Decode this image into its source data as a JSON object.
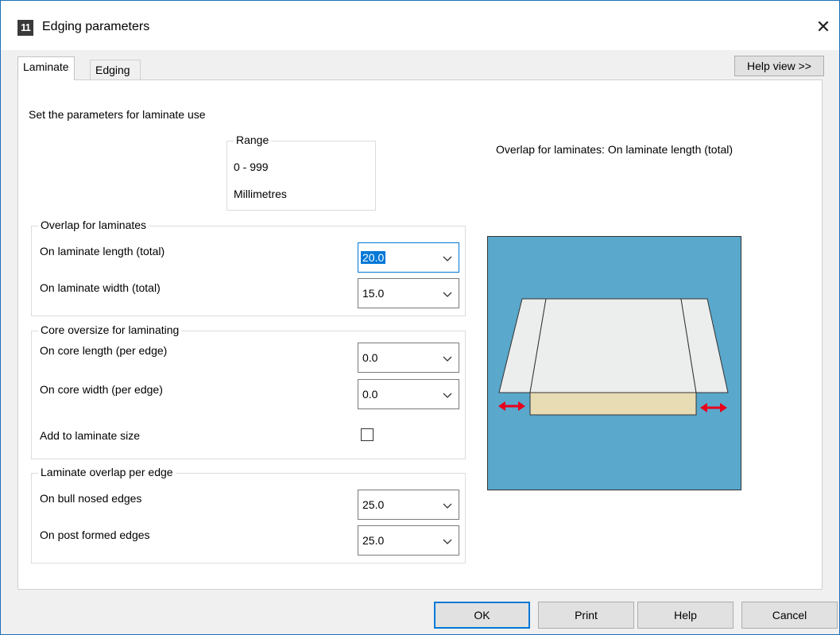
{
  "window": {
    "app_icon": "11",
    "title": "Edging parameters",
    "close_glyph": "✕"
  },
  "tabs": [
    {
      "label": "Laminate",
      "selected": true
    },
    {
      "label": "Edging",
      "selected": false
    }
  ],
  "help_view_label": "Help view >>",
  "intro": "Set the parameters for laminate use",
  "range": {
    "title": "Range",
    "values": "0 - 999",
    "units": "Millimetres"
  },
  "overlap_group": {
    "title": "Overlap for laminates",
    "fields": [
      {
        "label": "On laminate length (total)",
        "value": "20.0"
      },
      {
        "label": "On laminate width (total)",
        "value": "15.0"
      }
    ]
  },
  "core_group": {
    "title": "Core oversize for laminating",
    "fields": [
      {
        "label": "On core length (per edge)",
        "value": "0.0"
      },
      {
        "label": "On core width (per edge)",
        "value": "0.0"
      }
    ],
    "checkbox_label": "Add to laminate size",
    "checkbox_checked": false
  },
  "edge_group": {
    "title": "Laminate overlap per edge",
    "fields": [
      {
        "label": "On bull nosed edges",
        "value": "25.0"
      },
      {
        "label": "On post formed edges",
        "value": "25.0"
      }
    ]
  },
  "preview_caption": "Overlap for laminates: On laminate length (total)",
  "colors": {
    "preview_bg": "#5aa8cc",
    "laminate": "#eceeed",
    "core": "#e8dcb5",
    "arrow": "#e8001c",
    "accent": "#0078d7"
  },
  "buttons": {
    "ok": "OK",
    "print": "Print",
    "help": "Help",
    "cancel": "Cancel"
  }
}
